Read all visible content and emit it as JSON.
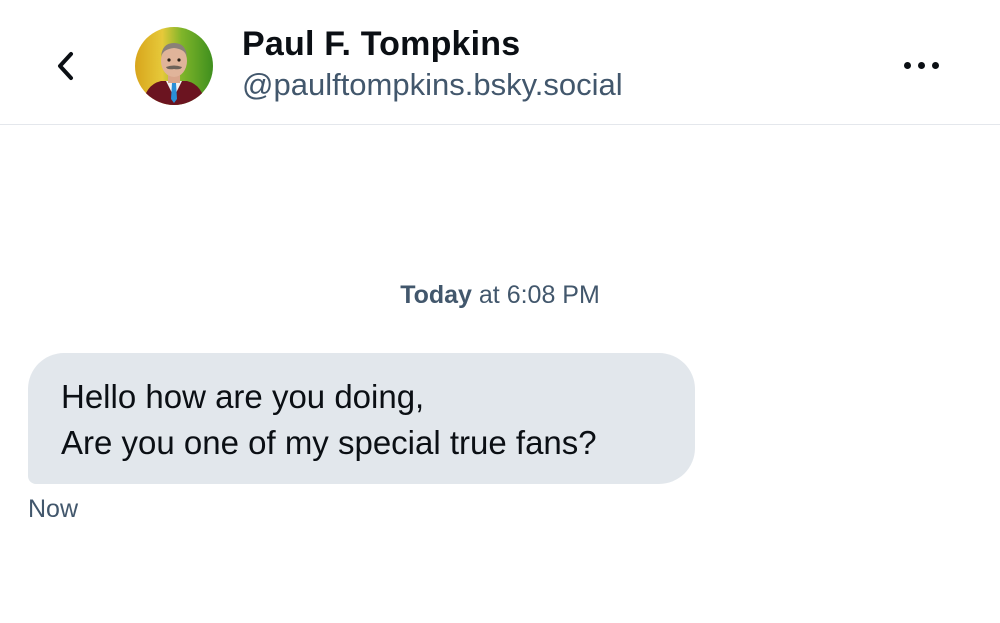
{
  "header": {
    "back_icon": "chevron-left-icon",
    "contact_name": "Paul F. Tompkins",
    "contact_handle": "@paulftompkins.bsky.social",
    "more_icon": "ellipsis-icon"
  },
  "conversation": {
    "date_separator": {
      "day": "Today",
      "time": "at 6:08 PM"
    },
    "messages": [
      {
        "lines": [
          "Hello how are you doing,",
          "Are you one of my special true fans?"
        ],
        "time": "Now"
      }
    ]
  },
  "colors": {
    "bubble_background": "#e2e7ec",
    "secondary_text": "#42576c",
    "primary_text": "#0b0f14",
    "divider": "#e4e7ec"
  }
}
